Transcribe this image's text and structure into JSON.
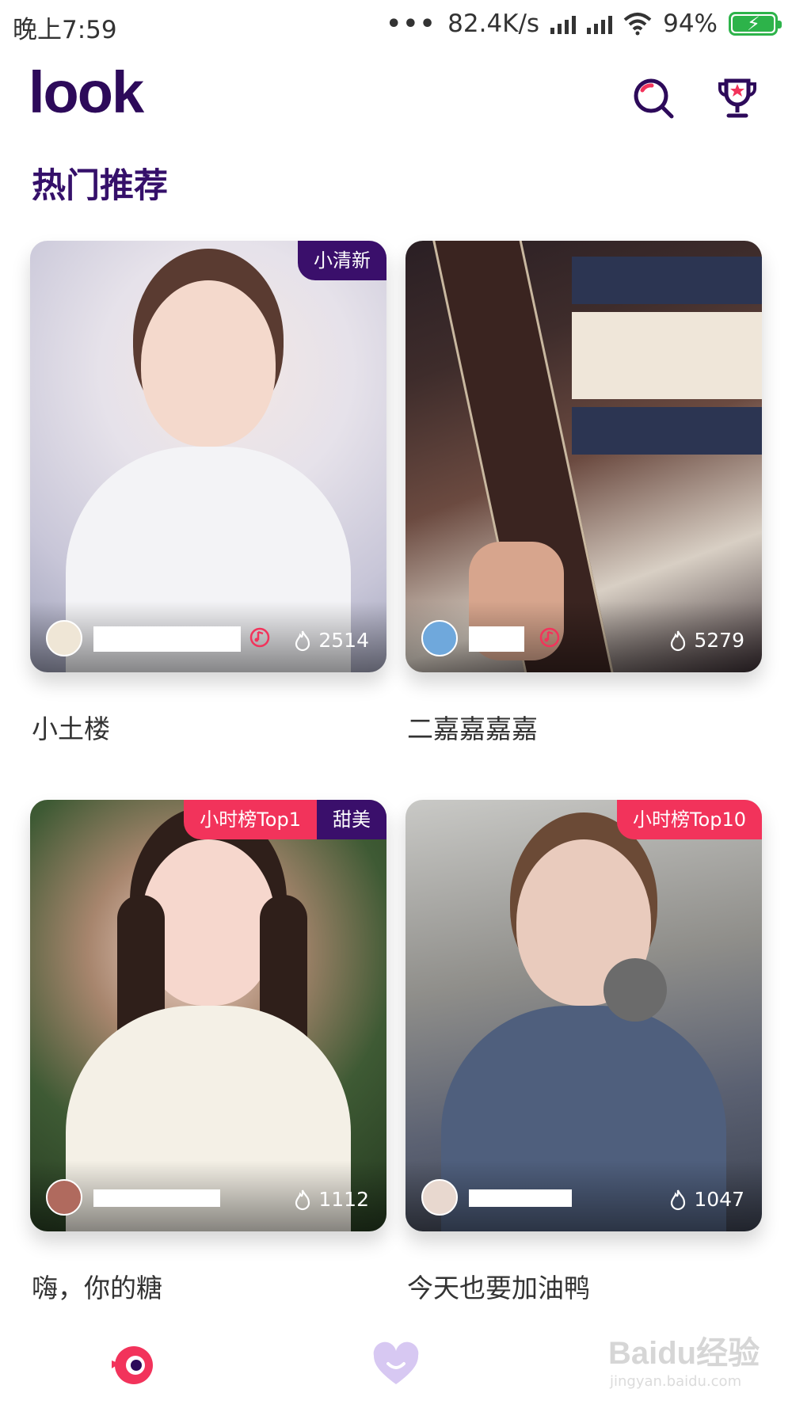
{
  "status_bar": {
    "time": "晚上7:59",
    "dots": "•••",
    "speed": "82.4K/s",
    "battery": "94%"
  },
  "header": {
    "logo": "look",
    "icons": [
      "search-icon",
      "trophy-icon"
    ],
    "brand_color": "#2d0a5a"
  },
  "section": {
    "title": "热门推荐"
  },
  "cards": [
    {
      "title": "小土楼",
      "tags": [
        "小清新"
      ],
      "heat": "2514"
    },
    {
      "title": "二嘉嘉嘉嘉",
      "tags": [],
      "heat": "5279"
    },
    {
      "title": "嗨，你的糖",
      "tags": [
        "小时榜Top1",
        "甜美"
      ],
      "heat": "1112"
    },
    {
      "title": "今天也要加油鸭",
      "tags": [
        "小时榜Top10"
      ],
      "heat": "1047"
    }
  ],
  "bottom_nav": {
    "items": [
      "discover-icon",
      "heart-icon"
    ],
    "active_color": "#f2335b",
    "inactive_color": "#d7c8f2"
  },
  "watermark": {
    "text": "Baidu经验",
    "subtext": "jingyan.baidu.com"
  }
}
